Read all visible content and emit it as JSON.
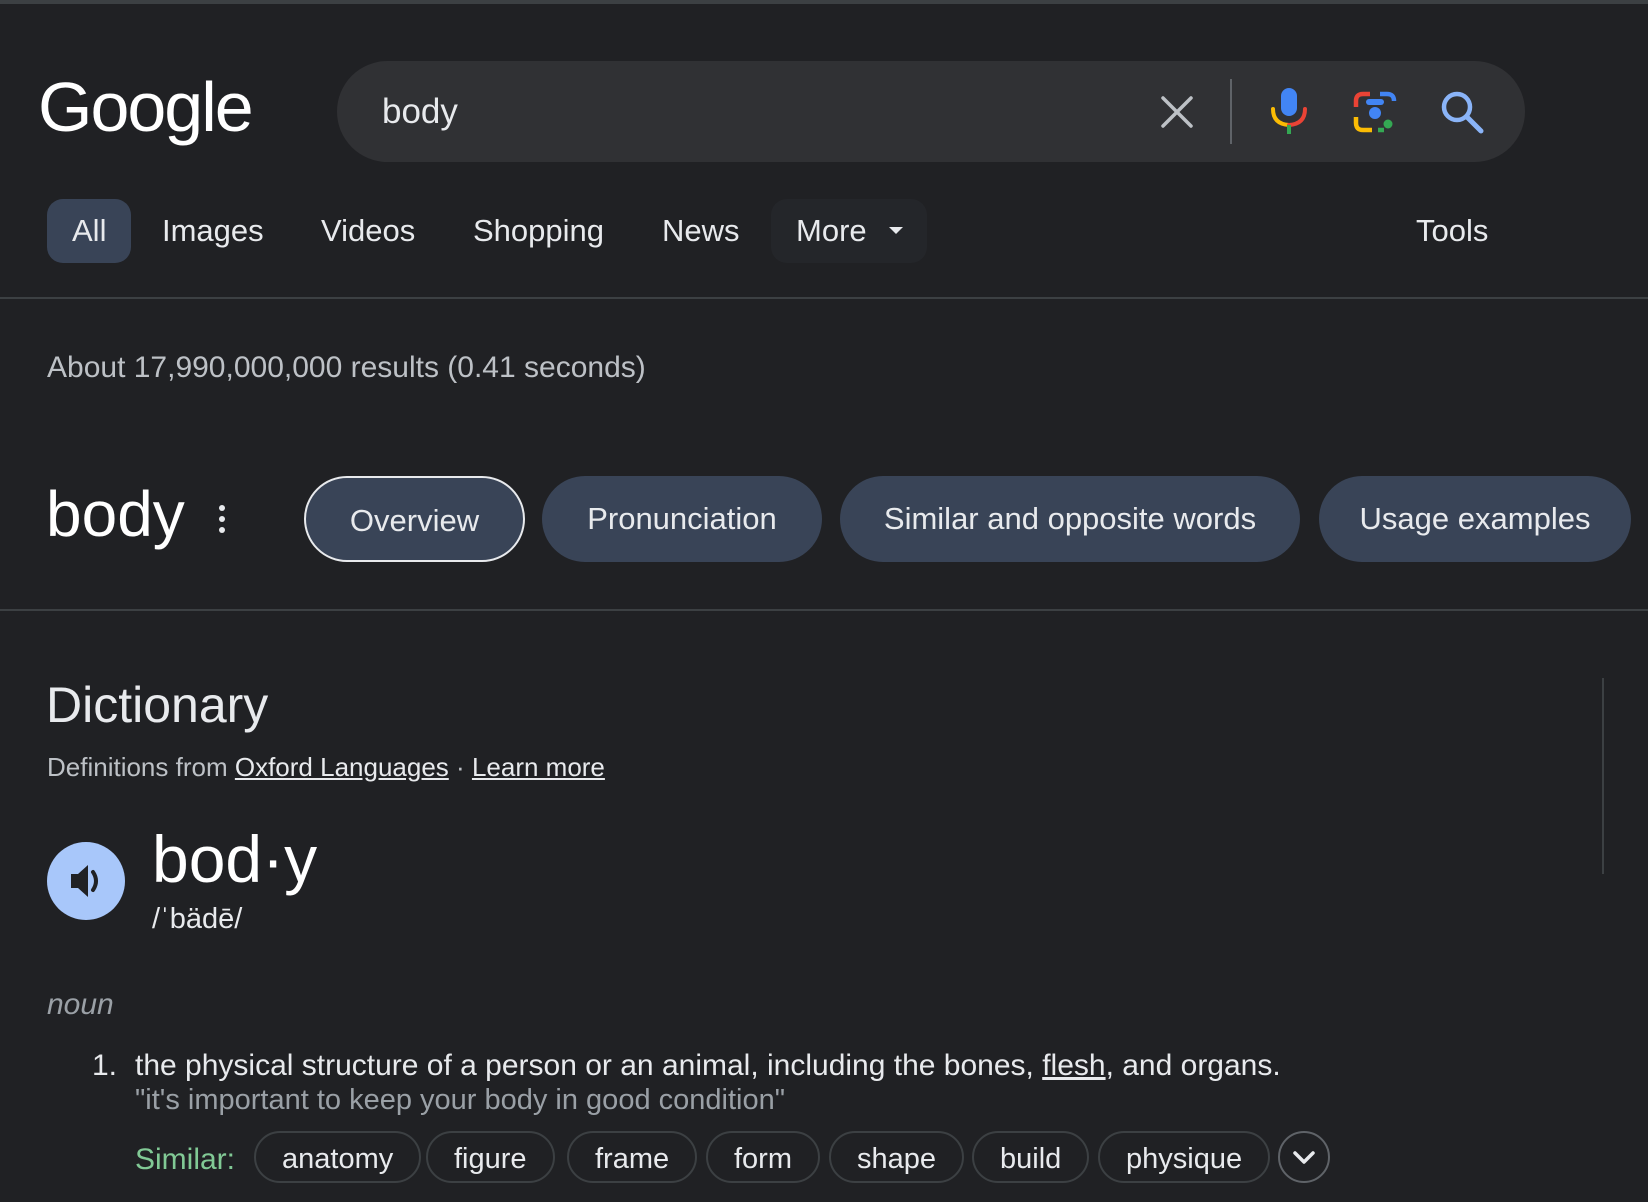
{
  "header": {
    "logo_text": "Google",
    "search_value": "body"
  },
  "tabs": [
    "All",
    "Images",
    "Videos",
    "Shopping",
    "News",
    "More"
  ],
  "tools_label": "Tools",
  "stats": "About 17,990,000,000 results (0.41 seconds)",
  "word_header": {
    "word": "body",
    "chips": [
      "Overview",
      "Pronunciation",
      "Similar and opposite words",
      "Usage examples"
    ]
  },
  "dictionary": {
    "title": "Dictionary",
    "source_prefix": "Definitions from",
    "source_link": "Oxford Languages",
    "separator": "·",
    "learn_more": "Learn more",
    "headword": "bod·y",
    "phonetic": "/ˈbädē/",
    "part_of_speech": "noun",
    "definition": {
      "number": "1.",
      "text_before": "the physical structure of a person or an animal, including the bones,",
      "link_word": "flesh",
      "text_after": ", and organs.",
      "example": "\"it's important to keep your body in good condition\"",
      "similar_label": "Similar:",
      "similar": [
        "anatomy",
        "figure",
        "frame",
        "form",
        "shape",
        "build",
        "physique"
      ]
    }
  },
  "colors": {
    "background": "#202124",
    "search_bg": "#303134",
    "chip_bg": "#394457",
    "speaker_bg": "#a8c7fa",
    "similar_green": "#81c995"
  }
}
